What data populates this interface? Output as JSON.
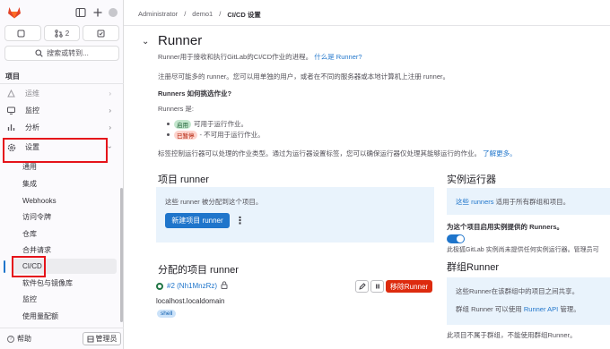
{
  "sidebar": {
    "todo_count": "",
    "mr_count": "2",
    "search_label": "搜索或转到...",
    "section_title": "项目",
    "nav": [
      {
        "label": "运维",
        "icon": "deploy-icon"
      },
      {
        "label": "监控",
        "icon": "monitor-icon"
      },
      {
        "label": "分析",
        "icon": "chart-icon"
      },
      {
        "label": "设置",
        "icon": "settings-icon"
      }
    ],
    "settings_sub": [
      "通用",
      "集成",
      "Webhooks",
      "访问令牌",
      "仓库",
      "合并请求",
      "CI/CD",
      "软件包与镜像库",
      "监控",
      "使用量配额"
    ],
    "help_label": "帮助",
    "admin_label": "管理员"
  },
  "breadcrumb": [
    "Administrator",
    "demo1",
    "CI/CD 设置"
  ],
  "runner_section": {
    "title": "Runner",
    "desc": "Runner用于接收和执行GitLab的CI/CD作业的进程。",
    "what_is_link": "什么是 Runner?",
    "register_text": "注册尽可能多的 runner。您可以用单独的用户，或者在不同的服务器或本地计算机上注册 runner。",
    "choose_title": "Runners 如何挑选作业?",
    "states_label": "Runners 是:",
    "state_online_badge": "启用",
    "state_online_text": "可用于运行作业。",
    "state_paused_badge": "已暂停",
    "state_paused_text": "- 不可用于运行作业。",
    "tags_text": "标签控制运行器可以处理的作业类型。通过为运行器设置标签，您可以确保运行器仅处理其能够运行的作业。",
    "learn_more": "了解更多。"
  },
  "project_runners": {
    "title": "项目 runner",
    "info": "这些 runner 被分配到这个项目。",
    "new_button": "新建项目 runner"
  },
  "assigned_runners": {
    "title": "分配的项目 runner",
    "runner_id": "#2 (Nh1MnzRz)",
    "host": "localhost.localdomain",
    "tag": "shell",
    "remove_button": "移除Runner"
  },
  "instance_runners": {
    "title": "实例运行器",
    "info_link": "这些 runners",
    "info_rest": "适用于所有群组和项目。",
    "enable_label": "为这个项目启用实例提供的 Runners。",
    "enable_note": "此极狐GitLab 实例尚未提供任何实例运行器。管理员可"
  },
  "group_runners": {
    "title": "群组Runner",
    "info": "这些Runner在该群组中的项目之间共享。",
    "api_prefix": "群组 Runner 可以使用",
    "api_link": "Runner API",
    "api_suffix": "管理。",
    "footer": "此项目不属于群组，不能使用群组Runner。"
  },
  "colors": {
    "accent": "#1f75cb",
    "danger": "#dd2b0e",
    "highlight": "#e5131a"
  }
}
